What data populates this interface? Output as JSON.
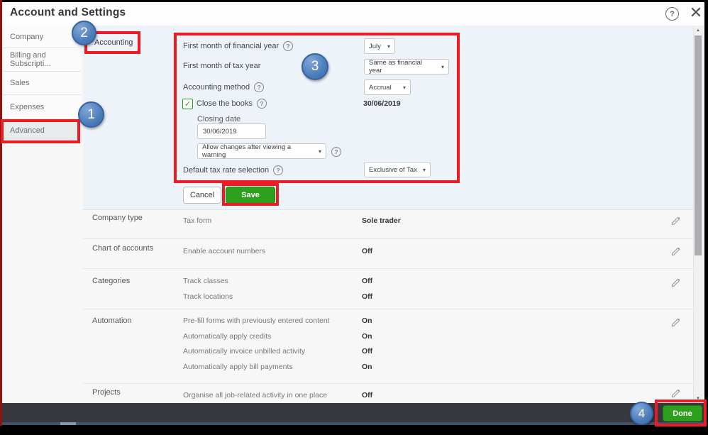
{
  "dialog": {
    "title": "Account and Settings"
  },
  "icons": {
    "help": "?",
    "close": "✕",
    "caret": "▾",
    "check": "✓",
    "up": "▲",
    "down": "▼",
    "info": "?"
  },
  "sidebar": {
    "items": [
      {
        "label": "Company"
      },
      {
        "label": "Billing and Subscripti..."
      },
      {
        "label": "Sales"
      },
      {
        "label": "Expenses"
      },
      {
        "label": "Advanced"
      }
    ]
  },
  "accounting": {
    "section_label": "Accounting",
    "first_month_financial_year": {
      "label": "First month of financial year",
      "value": "July"
    },
    "first_month_tax_year": {
      "label": "First month of tax year",
      "value": "Same as financial year"
    },
    "accounting_method": {
      "label": "Accounting method",
      "value": "Accrual"
    },
    "close_the_books": {
      "label": "Close the books",
      "value": "30/06/2019",
      "checked": true
    },
    "closing_date": {
      "label": "Closing date",
      "value": "30/06/2019"
    },
    "warning_mode": {
      "value": "Allow changes after viewing a warning"
    },
    "default_tax_rate": {
      "label": "Default tax rate selection",
      "value": "Exclusive of Tax"
    },
    "cancel_label": "Cancel",
    "save_label": "Save"
  },
  "rows": [
    {
      "section": "Company type",
      "settings": [
        {
          "name": "Tax form",
          "value": "Sole trader"
        }
      ]
    },
    {
      "section": "Chart of accounts",
      "settings": [
        {
          "name": "Enable account numbers",
          "value": "Off"
        }
      ]
    },
    {
      "section": "Categories",
      "settings": [
        {
          "name": "Track classes",
          "value": "Off"
        },
        {
          "name": "Track locations",
          "value": "Off"
        }
      ]
    },
    {
      "section": "Automation",
      "settings": [
        {
          "name": "Pre-fill forms with previously entered content",
          "value": "On"
        },
        {
          "name": "Automatically apply credits",
          "value": "On"
        },
        {
          "name": "Automatically invoice unbilled activity",
          "value": "Off"
        },
        {
          "name": "Automatically apply bill payments",
          "value": "On"
        }
      ]
    },
    {
      "section": "Projects",
      "settings": [
        {
          "name": "Organise all job-related activity in one place",
          "value": "Off"
        }
      ]
    }
  ],
  "footer": {
    "done_label": "Done"
  },
  "annotations": {
    "steps": [
      "1",
      "2",
      "3",
      "4"
    ]
  },
  "colors": {
    "accent_green": "#2ca01c",
    "annotation_red": "#ec1c24",
    "annotation_blue": "#4a7cba"
  }
}
